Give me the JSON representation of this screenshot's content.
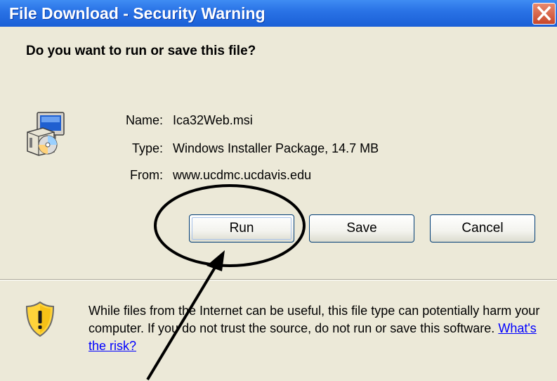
{
  "window": {
    "title": "File Download - Security Warning",
    "close_label": "X"
  },
  "dialog": {
    "question": "Do you want to run or save this file?",
    "file_icon": "installer-package-icon",
    "fields": [
      {
        "label": "Name:",
        "value": "Ica32Web.msi"
      },
      {
        "label": "Type:",
        "value": "Windows Installer Package, 14.7 MB"
      },
      {
        "label": "From:",
        "value": "www.ucdmc.ucdavis.edu"
      }
    ],
    "buttons": {
      "run": "Run",
      "save": "Save",
      "cancel": "Cancel"
    },
    "warning": {
      "icon": "shield-warning-icon",
      "text": "While files from the Internet can be useful, this file type can potentially harm your computer. If you do not trust the source, do not run or save this software.",
      "link": "What's the risk?"
    }
  },
  "annotation": {
    "shapes": [
      "circle-highlight",
      "pointer-arrow"
    ],
    "color": "#000000"
  },
  "colors": {
    "titlebar": "#2a73e6",
    "dialog_bg": "#ece9d8",
    "link": "#0000ff"
  }
}
